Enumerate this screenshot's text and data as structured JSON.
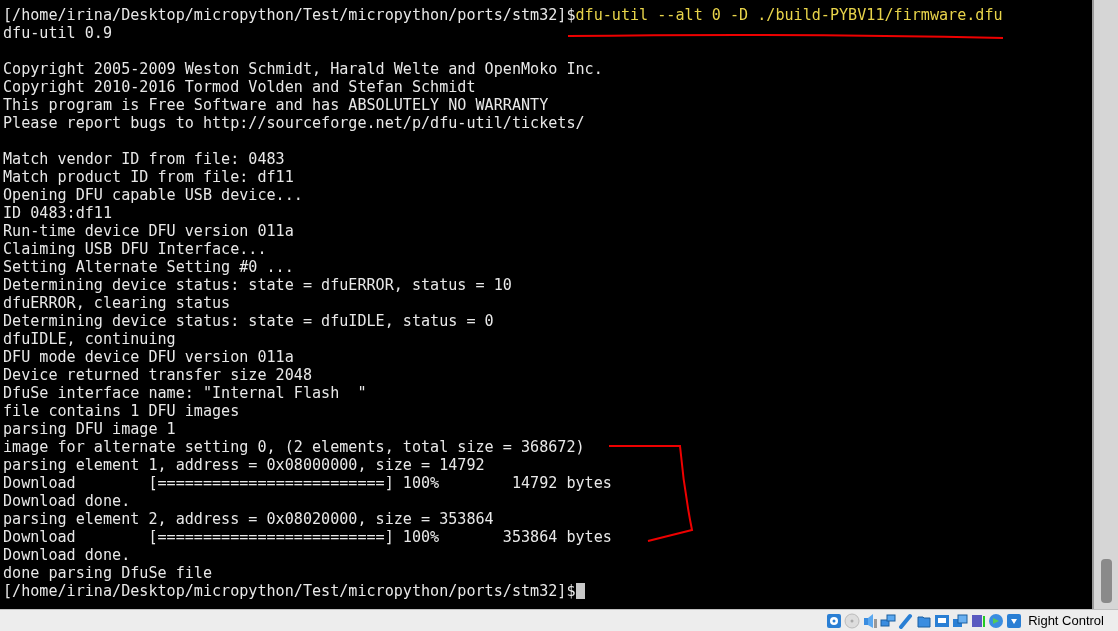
{
  "terminal": {
    "lines": [
      {
        "kind": "prompt",
        "prompt": "[/home/irina/Desktop/micropython/Test/micropython/ports/stm32]$",
        "command": "dfu-util --alt 0 -D ./build-PYBV11/firmware.dfu",
        "cursor": false
      },
      {
        "kind": "output",
        "text": "dfu-util 0.9"
      },
      {
        "kind": "blank"
      },
      {
        "kind": "output",
        "text": "Copyright 2005-2009 Weston Schmidt, Harald Welte and OpenMoko Inc."
      },
      {
        "kind": "output",
        "text": "Copyright 2010-2016 Tormod Volden and Stefan Schmidt"
      },
      {
        "kind": "output",
        "text": "This program is Free Software and has ABSOLUTELY NO WARRANTY"
      },
      {
        "kind": "output",
        "text": "Please report bugs to http://sourceforge.net/p/dfu-util/tickets/"
      },
      {
        "kind": "blank"
      },
      {
        "kind": "output",
        "text": "Match vendor ID from file: 0483"
      },
      {
        "kind": "output",
        "text": "Match product ID from file: df11"
      },
      {
        "kind": "output",
        "text": "Opening DFU capable USB device..."
      },
      {
        "kind": "output",
        "text": "ID 0483:df11"
      },
      {
        "kind": "output",
        "text": "Run-time device DFU version 011a"
      },
      {
        "kind": "output",
        "text": "Claiming USB DFU Interface..."
      },
      {
        "kind": "output",
        "text": "Setting Alternate Setting #0 ..."
      },
      {
        "kind": "output",
        "text": "Determining device status: state = dfuERROR, status = 10"
      },
      {
        "kind": "output",
        "text": "dfuERROR, clearing status"
      },
      {
        "kind": "output",
        "text": "Determining device status: state = dfuIDLE, status = 0"
      },
      {
        "kind": "output",
        "text": "dfuIDLE, continuing"
      },
      {
        "kind": "output",
        "text": "DFU mode device DFU version 011a"
      },
      {
        "kind": "output",
        "text": "Device returned transfer size 2048"
      },
      {
        "kind": "output",
        "text": "DfuSe interface name: \"Internal Flash  \""
      },
      {
        "kind": "output",
        "text": "file contains 1 DFU images"
      },
      {
        "kind": "output",
        "text": "parsing DFU image 1"
      },
      {
        "kind": "output",
        "text": "image for alternate setting 0, (2 elements, total size = 368672)"
      },
      {
        "kind": "output",
        "text": "parsing element 1, address = 0x08000000, size = 14792"
      },
      {
        "kind": "output",
        "text": "Download\t[=========================] 100%        14792 bytes"
      },
      {
        "kind": "output",
        "text": "Download done."
      },
      {
        "kind": "output",
        "text": "parsing element 2, address = 0x08020000, size = 353864"
      },
      {
        "kind": "output",
        "text": "Download\t[=========================] 100%       353864 bytes"
      },
      {
        "kind": "output",
        "text": "Download done."
      },
      {
        "kind": "output",
        "text": "done parsing DfuSe file"
      },
      {
        "kind": "prompt",
        "prompt": "[/home/irina/Desktop/micropython/Test/micropython/ports/stm32]$",
        "cursor": true
      }
    ]
  },
  "status_bar": {
    "host_key": "Right Control"
  }
}
